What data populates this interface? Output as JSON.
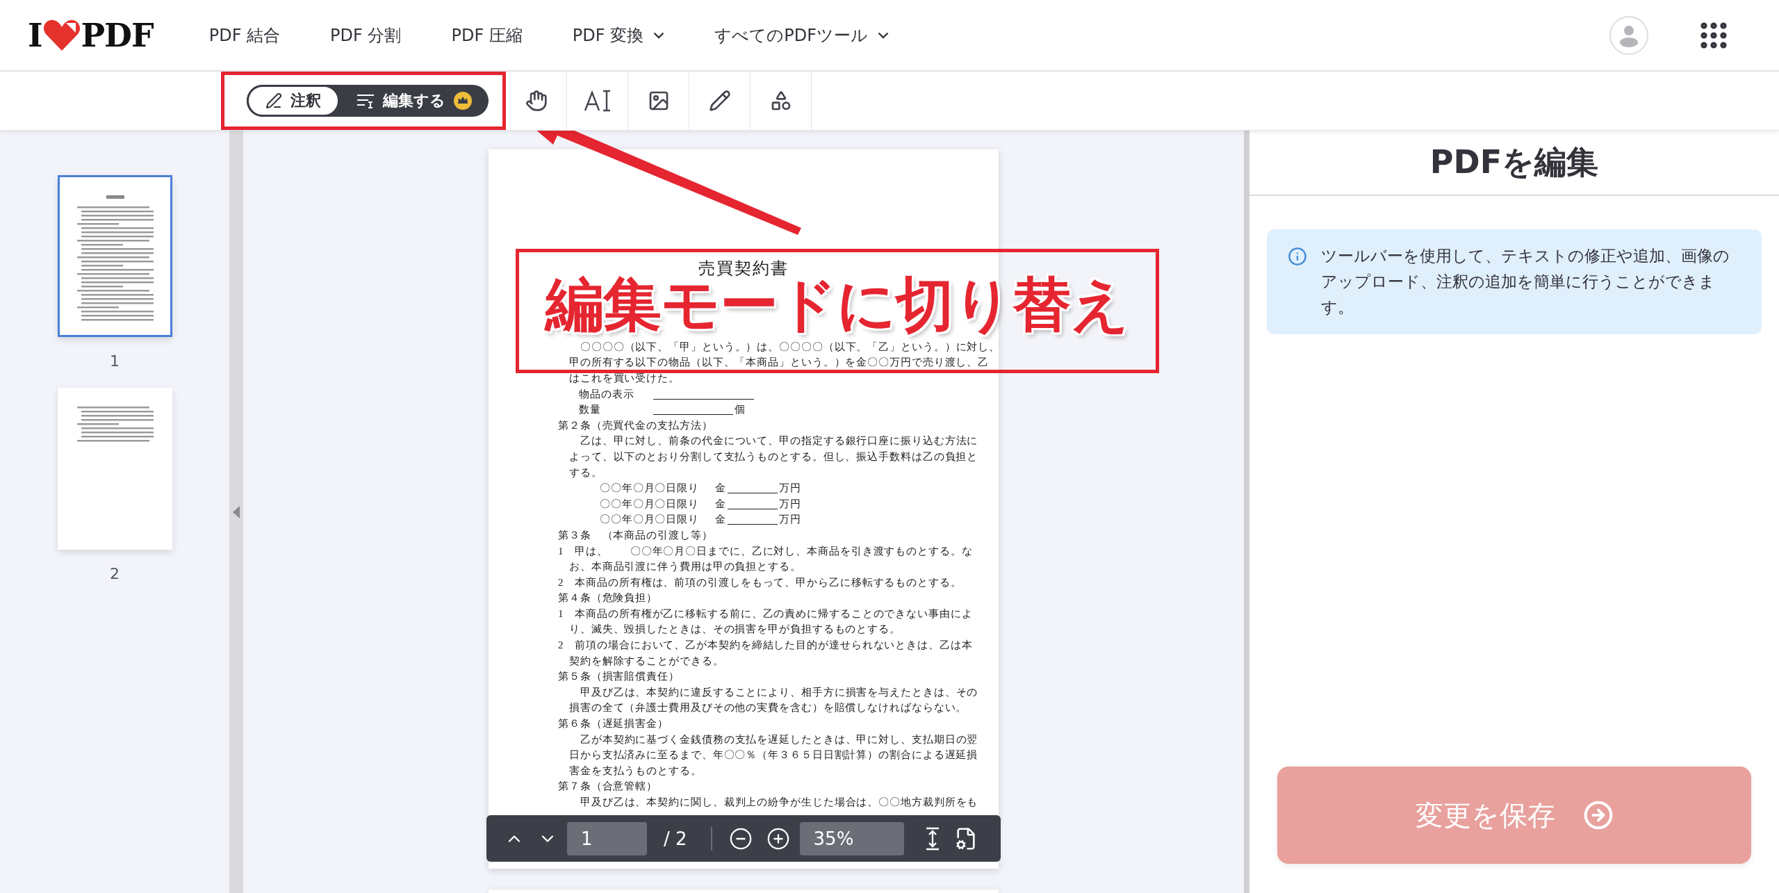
{
  "header": {
    "logo": {
      "left": "I",
      "right": "PDF"
    },
    "nav": [
      {
        "label": "PDF 結合",
        "dropdown": false
      },
      {
        "label": "PDF 分割",
        "dropdown": false
      },
      {
        "label": "PDF 圧縮",
        "dropdown": false
      },
      {
        "label": "PDF 変換",
        "dropdown": true
      },
      {
        "label": "すべてのPDFツール",
        "dropdown": true
      }
    ]
  },
  "toolbar": {
    "modes": [
      {
        "label": "注釈",
        "kind": "annotate",
        "selected": true,
        "premium": false
      },
      {
        "label": "編集する",
        "kind": "edit",
        "selected": false,
        "premium": true
      }
    ],
    "tools": [
      {
        "kind": "hand"
      },
      {
        "kind": "text"
      },
      {
        "kind": "image"
      },
      {
        "kind": "pencil"
      },
      {
        "kind": "shapes"
      }
    ]
  },
  "thumbnails": [
    {
      "label": "1",
      "selected": true,
      "kind": "full"
    },
    {
      "label": "2",
      "selected": false,
      "kind": "short"
    }
  ],
  "document": {
    "title": "売買契約書",
    "lines": [
      {
        "kind": "body",
        "text": "〇〇〇〇（以下、「甲」という。）は、〇〇〇〇（以下、「乙」という。）に対し、"
      },
      {
        "kind": "wrap",
        "text": "甲の所有する以下の物品（以下、「本商品」という。）を金〇〇万円で売り渡し、乙"
      },
      {
        "kind": "wrap",
        "text": "はこれを買い受けた。"
      },
      {
        "kind": "field",
        "text": "物品の表示"
      },
      {
        "kind": "field",
        "text": "数量",
        "suffix": "個"
      },
      {
        "kind": "heading",
        "text": "第２条（売買代金の支払方法）"
      },
      {
        "kind": "body",
        "text": "乙は、甲に対し、前条の代金について、甲の指定する銀行口座に振り込む方法に"
      },
      {
        "kind": "wrap",
        "text": "よって、以下のとおり分割して支払うものとする。但し、振込手数料は乙の負担と"
      },
      {
        "kind": "wrap",
        "text": "する。"
      },
      {
        "kind": "installment",
        "text": "〇〇年〇月〇日限り",
        "prefix": "金",
        "suffix": "万円"
      },
      {
        "kind": "installment",
        "text": "〇〇年〇月〇日限り",
        "prefix": "金",
        "suffix": "万円"
      },
      {
        "kind": "installment",
        "text": "〇〇年〇月〇日限り",
        "prefix": "金",
        "suffix": "万円"
      },
      {
        "kind": "heading",
        "text": "第３条　（本商品の引渡し等）"
      },
      {
        "kind": "numbered",
        "text": "1　甲は、　　〇〇年〇月〇日までに、乙に対し、本商品を引き渡すものとする。な"
      },
      {
        "kind": "wrap",
        "text": "お、本商品引渡に伴う費用は甲の負担とする。"
      },
      {
        "kind": "numbered",
        "text": "2　本商品の所有権は、前項の引渡しをもって、甲から乙に移転するものとする。"
      },
      {
        "kind": "heading",
        "text": "第４条（危険負担）"
      },
      {
        "kind": "numbered",
        "text": "1　本商品の所有権が乙に移転する前に、乙の責めに帰することのできない事由によ"
      },
      {
        "kind": "wrap",
        "text": "り、滅失、毀損したときは、その損害を甲が負担するものとする。"
      },
      {
        "kind": "numbered",
        "text": "2　前項の場合において、乙が本契約を締結した目的が達せられないときは、乙は本"
      },
      {
        "kind": "wrap",
        "text": "契約を解除することができる。"
      },
      {
        "kind": "heading",
        "text": "第５条（損害賠償責任）"
      },
      {
        "kind": "body",
        "text": "甲及び乙は、本契約に違反することにより、相手方に損害を与えたときは、その"
      },
      {
        "kind": "wrap",
        "text": "損害の全て（弁護士費用及びその他の実費を含む）を賠償しなければならない。"
      },
      {
        "kind": "heading",
        "text": "第６条（遅延損害金）"
      },
      {
        "kind": "body",
        "text": "乙が本契約に基づく金銭債務の支払を遅延したときは、甲に対し、支払期日の翌"
      },
      {
        "kind": "wrap",
        "text": "日から支払済みに至るまで、年〇〇％（年３６５日日割計算）の割合による遅延損"
      },
      {
        "kind": "wrap",
        "text": "害金を支払うものとする。"
      },
      {
        "kind": "heading",
        "text": "第７条（合意管轄）"
      },
      {
        "kind": "body",
        "text": "甲及び乙は、本契約に関し、裁判上の紛争が生じた場合は、〇〇地方裁判所をも"
      }
    ]
  },
  "pager": {
    "page": "1",
    "total": "/ 2",
    "zoom": "35%"
  },
  "panel": {
    "title": "PDFを編集",
    "info": "ツールバーを使用して、テキストの修正や追加、画像のアップロード、注釈の追加を簡単に行うことができます。",
    "save": {
      "label": "変更を保存",
      "disabled": true
    }
  },
  "callout": {
    "label": "編集モードに切り替え"
  }
}
